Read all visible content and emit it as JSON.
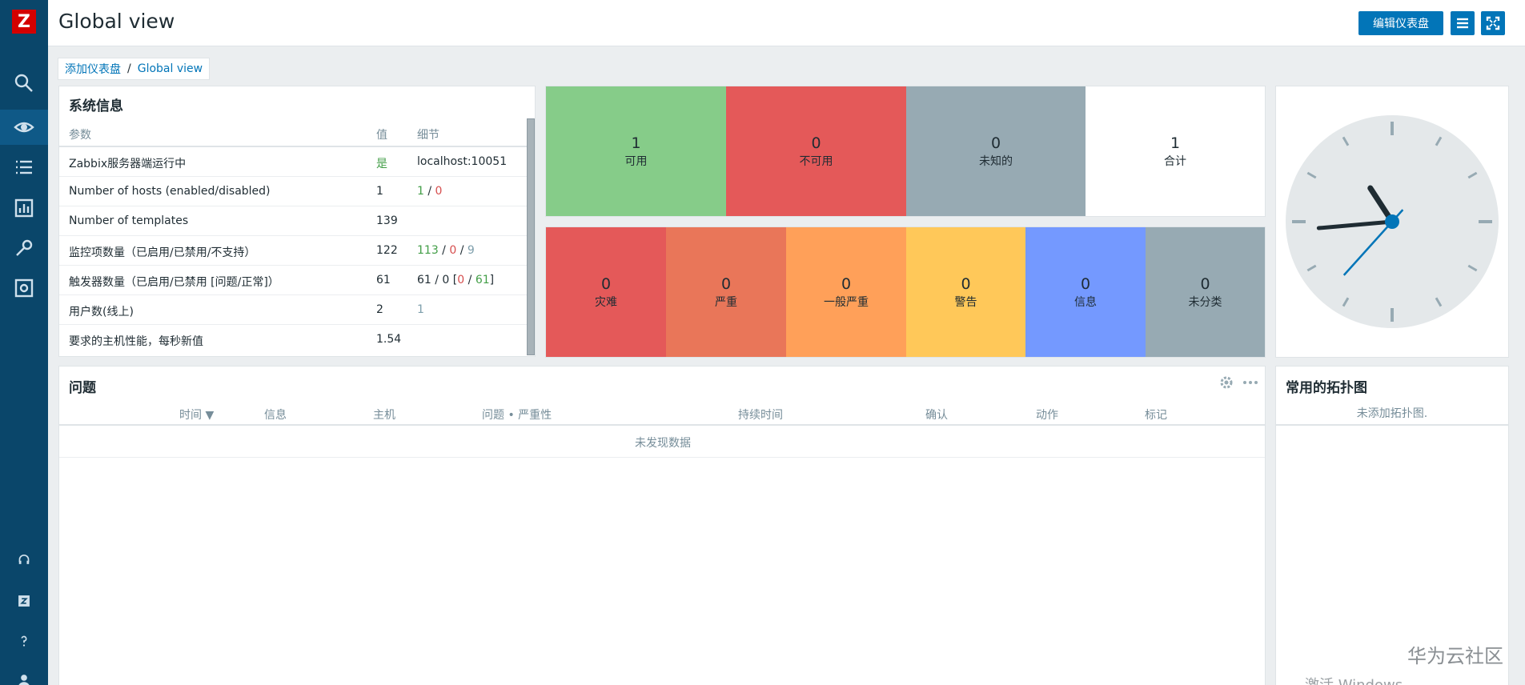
{
  "app": {
    "logo_letter": "Z"
  },
  "header": {
    "title": "Global view",
    "edit_button": "编辑仪表盘"
  },
  "breadcrumb": {
    "parent": "添加仪表盘",
    "current": "Global view"
  },
  "system_info": {
    "title": "系统信息",
    "columns": [
      "参数",
      "值",
      "细节"
    ],
    "rows": [
      {
        "param": "Zabbix服务器端运行中",
        "value": "是",
        "detail": "localhost:10051"
      },
      {
        "param": "Number of hosts (enabled/disabled)",
        "value": "1",
        "detail_a": "1",
        "detail_sep": " / ",
        "detail_b": "0"
      },
      {
        "param": "Number of templates",
        "value": "139"
      },
      {
        "param": "监控项数量（已启用/已禁用/不支持）",
        "value": "122",
        "detail_a": "113",
        "detail_sep1": " / ",
        "detail_b": "0",
        "detail_sep2": " / ",
        "detail_c": "9"
      },
      {
        "param": "触发器数量（已启用/已禁用 [问题/正常]）",
        "value": "61",
        "detail_prefix": "61 / 0 [",
        "detail_a": "0",
        "detail_sep": " / ",
        "detail_b": "61",
        "detail_suffix": "]"
      },
      {
        "param": "用户数(线上)",
        "value": "2",
        "detail": "1"
      },
      {
        "param": "要求的主机性能，每秒新值",
        "value": "1.54"
      }
    ]
  },
  "host_availability": [
    {
      "count": "1",
      "label": "可用",
      "color": "#86cc89"
    },
    {
      "count": "0",
      "label": "不可用",
      "color": "#e45959"
    },
    {
      "count": "0",
      "label": "未知的",
      "color": "#97aab3"
    },
    {
      "count": "1",
      "label": "合计",
      "color": "#ffffff"
    }
  ],
  "severities": [
    {
      "count": "0",
      "label": "灾难",
      "color": "#e45959"
    },
    {
      "count": "0",
      "label": "严重",
      "color": "#e97659"
    },
    {
      "count": "0",
      "label": "一般严重",
      "color": "#ffa059"
    },
    {
      "count": "0",
      "label": "警告",
      "color": "#ffc859"
    },
    {
      "count": "0",
      "label": "信息",
      "color": "#7499ff"
    },
    {
      "count": "0",
      "label": "未分类",
      "color": "#97aab3"
    }
  ],
  "problems": {
    "title": "问题",
    "columns": [
      "时间 ▼",
      "信息",
      "主机",
      "问题 • 严重性",
      "持续时间",
      "确认",
      "动作",
      "标记"
    ],
    "empty": "未发现数据"
  },
  "maps": {
    "title": "常用的拓扑图",
    "empty": "未添加拓扑图."
  },
  "clock": {
    "hour_angle": 327,
    "minute_angle": 265,
    "second_angle": 222
  },
  "watermark": {
    "text": "华为云社区",
    "text2": "激活 Windows"
  },
  "colors": {
    "sidebar": "#0a466a",
    "accent": "#0275b8"
  }
}
